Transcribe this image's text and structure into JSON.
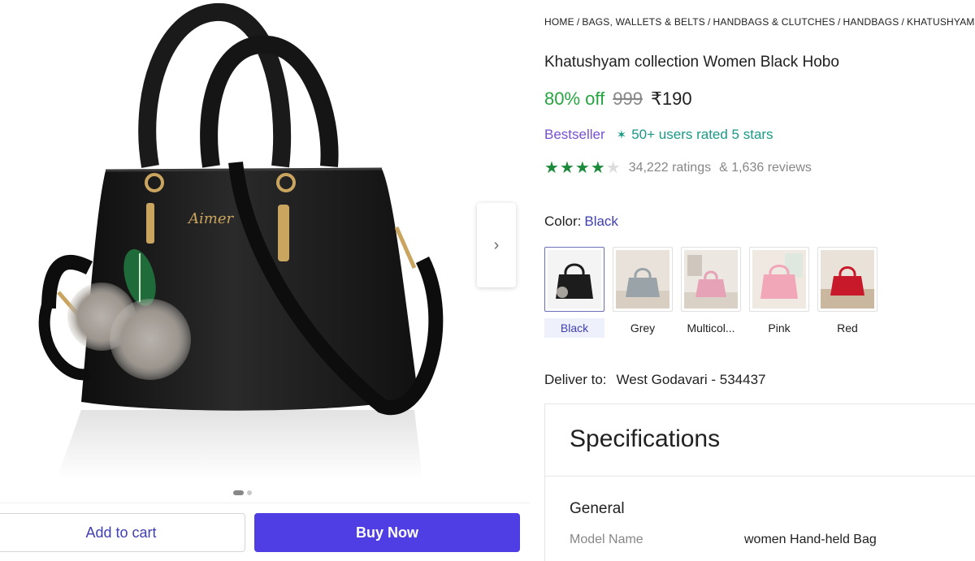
{
  "gallery": {
    "next_icon": "chevron-right-icon",
    "dots": 2,
    "active_dot": 0
  },
  "actions": {
    "add_to_cart": "Add to cart",
    "buy_now": "Buy Now"
  },
  "breadcrumb": [
    "Home",
    "Bags, Wallets & Belts",
    "Handbags & Clutches",
    "Handbags",
    "Khatushyam C"
  ],
  "product": {
    "title": "Khatushyam collection Women Black Hobo",
    "discount": "80% off",
    "mrp": "999",
    "price": "₹190",
    "bestseller": "Bestseller",
    "rated_text": "50+ users rated 5 stars",
    "rating_stars": 4,
    "ratings_count": "34,222 ratings",
    "reviews_count": "& 1,636 reviews"
  },
  "color": {
    "label": "Color:",
    "selected": "Black",
    "options": [
      {
        "name": "Black",
        "color": "#1c1c1c"
      },
      {
        "name": "Grey",
        "color": "#9aa3a8"
      },
      {
        "name": "Multicol...",
        "color": "#e6a3b8"
      },
      {
        "name": "Pink",
        "color": "#f2a7b8"
      },
      {
        "name": "Red",
        "color": "#c8192b"
      }
    ]
  },
  "delivery": {
    "label": "Deliver to:",
    "location": "West Godavari - 534437"
  },
  "specifications": {
    "title": "Specifications",
    "group": "General",
    "rows": [
      {
        "key": "Model Name",
        "value": "women Hand-held Bag"
      }
    ]
  },
  "colors": {
    "accent": "#4f3ee3",
    "discount_green": "#26a541",
    "link_blue": "#3f3fb3",
    "bestseller_purple": "#7650d1",
    "teal": "#1a9a86"
  }
}
